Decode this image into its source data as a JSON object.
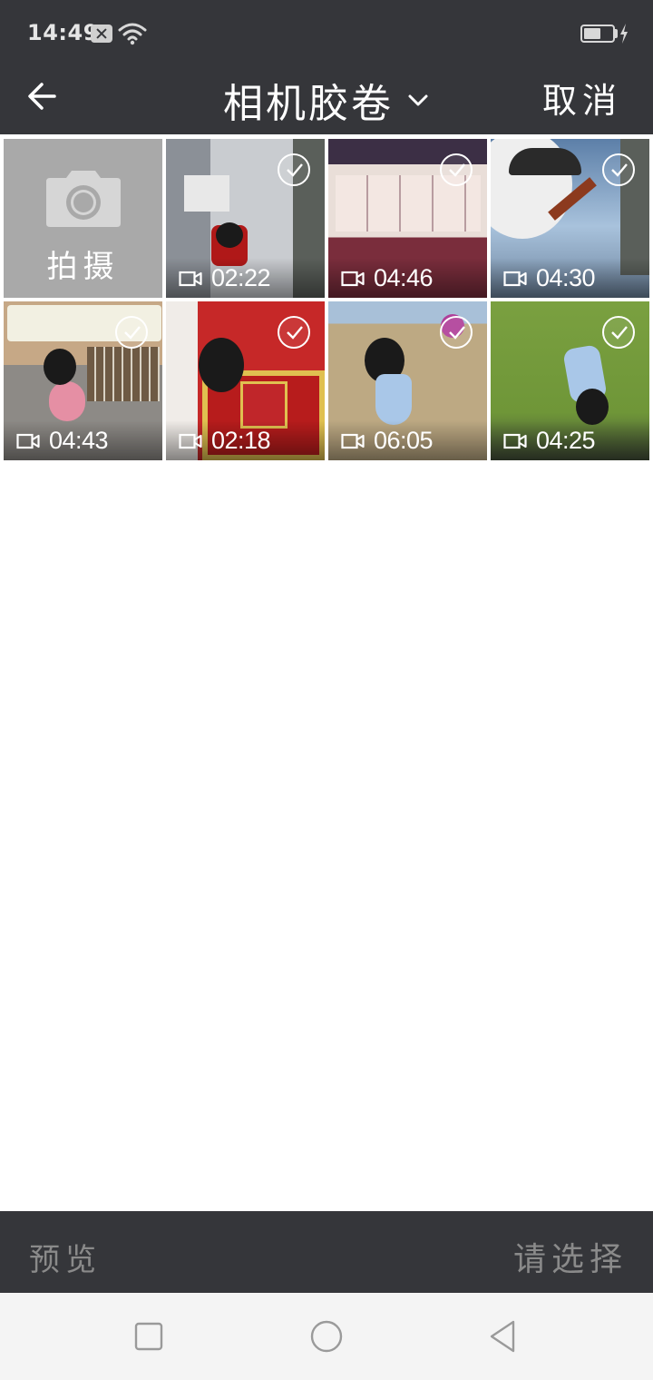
{
  "status_bar": {
    "time": "14:49",
    "icons": [
      "notification-x-icon",
      "wifi-icon",
      "battery-icon",
      "charging-bolt-icon"
    ]
  },
  "header": {
    "back_icon": "back-arrow-icon",
    "title": "相机胶卷",
    "title_icon": "chevron-down-icon",
    "cancel_label": "取消",
    "background": "#35363a"
  },
  "grid": {
    "camera_tile": {
      "icon": "camera-icon",
      "label": "拍摄",
      "background": "#a9a9a9"
    },
    "videos": [
      {
        "duration": "02:22",
        "icon": "video-camera-icon",
        "selected": false
      },
      {
        "duration": "04:46",
        "icon": "video-camera-icon",
        "selected": false
      },
      {
        "duration": "04:30",
        "icon": "video-camera-icon",
        "selected": false
      },
      {
        "duration": "04:43",
        "icon": "video-camera-icon",
        "selected": false
      },
      {
        "duration": "02:18",
        "icon": "video-camera-icon",
        "selected": false
      },
      {
        "duration": "06:05",
        "icon": "video-camera-icon",
        "selected": false
      },
      {
        "duration": "04:25",
        "icon": "video-camera-icon",
        "selected": false
      }
    ]
  },
  "bottom_bar": {
    "preview_label": "预览",
    "select_label": "请选择",
    "text_color": "#8a8a8a"
  },
  "nav_bar": {
    "buttons": [
      "recent-apps-square-icon",
      "home-circle-icon",
      "back-triangle-icon"
    ]
  }
}
